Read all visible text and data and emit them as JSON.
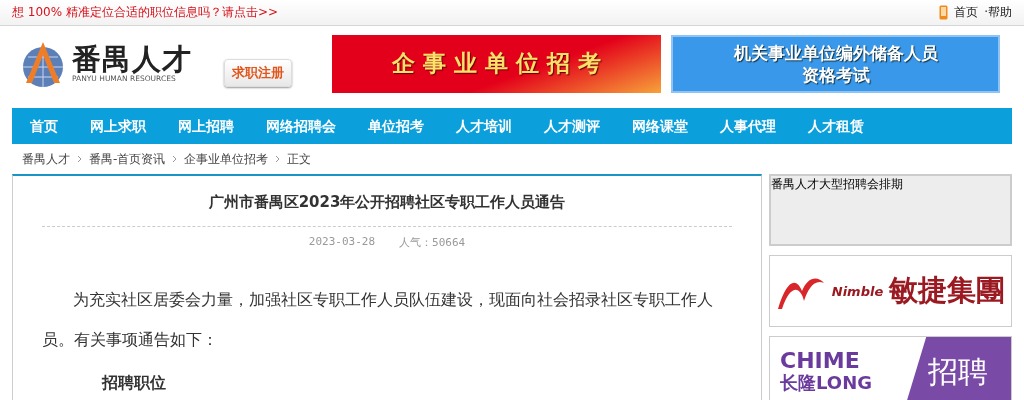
{
  "topbar": {
    "promo": "想 100% 精准定位合适的职位信息吗？请点击>>",
    "links": [
      "首页",
      "·帮助"
    ]
  },
  "header": {
    "logo": {
      "name": "番禺人才",
      "subtitle": "PANYU HUMAN RESOURCES"
    },
    "register_button": "求职注册",
    "banners": [
      {
        "kind": "red",
        "lines": [
          "企 事 业 单 位 招 考"
        ]
      },
      {
        "kind": "blue",
        "lines": [
          "机关事业单位编外储备人员",
          "资格考试"
        ]
      }
    ]
  },
  "nav": [
    {
      "label": "首页",
      "selected": false
    },
    {
      "label": "网上求职",
      "selected": false
    },
    {
      "label": "网上招聘",
      "selected": false
    },
    {
      "label": "网络招聘会",
      "selected": false
    },
    {
      "label": "单位招考",
      "selected": false
    },
    {
      "label": "人才培训",
      "selected": false
    },
    {
      "label": "人才测评",
      "selected": false
    },
    {
      "label": "网络课堂",
      "selected": false
    },
    {
      "label": "人事代理",
      "selected": false
    },
    {
      "label": "人才租赁",
      "selected": false
    }
  ],
  "breadcrumb": [
    "番禺人才",
    "番禺-首页资讯",
    "企事业单位招考",
    "正文"
  ],
  "article": {
    "title": "广州市番禺区2023年公开招聘社区专职工作人员通告",
    "date": "2023-03-28",
    "views": "人气：50664",
    "paragraph": "为充实社区居委会力量，加强社区专职工作人员队伍建设，现面向社会招录社区专职工作人员。有关事项通告如下：",
    "section_heading": "招聘职位"
  },
  "sidebar": {
    "schedule_title": "番禺人才大型招聘会排期",
    "ads": [
      {
        "kind": "nimble",
        "texts": [
          "Nimble",
          "敏捷集團"
        ]
      },
      {
        "kind": "chime",
        "texts": [
          "CHIME",
          "长隆LONG",
          "招聘"
        ]
      }
    ]
  }
}
